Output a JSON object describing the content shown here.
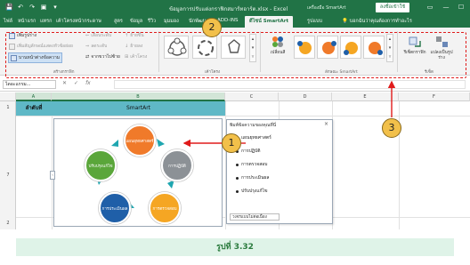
{
  "titlebar": {
    "quick_access": [
      "💾",
      "↶",
      "↷",
      "▣",
      "▾"
    ],
    "doc_title": "ข้อมูลการปรับแต่งกราฟิกสมาร์ทอาร์ต.xlsx - Excel",
    "tools_title": "เครื่องมือ SmartArt",
    "signin": "ลงชื่อเข้าใช้",
    "window_buttons": [
      "▭",
      "—",
      "☐"
    ]
  },
  "tabs": [
    {
      "label": "ไฟล์",
      "active": false
    },
    {
      "label": "หน้าแรก",
      "active": false
    },
    {
      "label": "แทรก",
      "active": false
    },
    {
      "label": "เค้าโครงหน้ากระดาษ",
      "active": false
    },
    {
      "label": "สูตร",
      "active": false
    },
    {
      "label": "ข้อมูล",
      "active": false
    },
    {
      "label": "รีวิว",
      "active": false
    },
    {
      "label": "มุมมอง",
      "active": false
    },
    {
      "label": "นักพัฒนา",
      "active": false
    },
    {
      "label": "ADD-INS",
      "active": false
    },
    {
      "label": "ดีไซน์ SmartArt",
      "active": true
    },
    {
      "label": "รูปแบบ",
      "active": false
    }
  ],
  "tellme": "บอกฉันว่าคุณต้องการทำอะไร",
  "ribbon": {
    "create_graphic": {
      "add_shape": "เพิ่มรูปร่าง",
      "add_bullet": "เพิ่มสัญลักษณ์แสดงหัวข้อย่อย",
      "text_pane": "บานหน้าต่างข้อความ",
      "promote": "เลื่อนระดับ",
      "demote": "ลดระดับ",
      "right_to_left": "จากขวาไปซ้าย",
      "move_up": "ย้ายขึ้น",
      "move_down": "ย้ายลง",
      "layout": "เค้าโครง",
      "label": "สร้างกราฟิก"
    },
    "layouts_label": "เค้าโครง",
    "change_colors": "เปลี่ยนสี",
    "styles_label": "ลักษณะ SmartArt",
    "reset_graphic": "รีเซ็ตกราฟิก",
    "convert": "แปลงเป็นรูปร่าง",
    "reset_label": "รีเซ็ต"
  },
  "formula_bar": {
    "name_box": "ไดอะแกรม...",
    "cancel": "✕",
    "enter": "✓",
    "fx": "fx",
    "value": ""
  },
  "columns": [
    "A",
    "B",
    "C",
    "D",
    "E",
    "F"
  ],
  "rows": [
    "1",
    "7",
    "2"
  ],
  "sheet": {
    "a1": "ลำดับที่",
    "b1": "SmartArt",
    "a7": "7"
  },
  "smartart": {
    "nodes": [
      {
        "label": "แผนยุทธศาสตร์",
        "color": "#f07a2a"
      },
      {
        "label": "การปฏิบัติ",
        "color": "#8c9196"
      },
      {
        "label": "การตรวจสอบ",
        "color": "#f5a623"
      },
      {
        "label": "การประเมินผล",
        "color": "#1f5fa8"
      },
      {
        "label": "ปรับปรุงแก้ไข",
        "color": "#5aa63a"
      }
    ],
    "handle": "‹"
  },
  "text_pane": {
    "title": "พิมพ์ข้อความของคุณที่นี่",
    "close": "×",
    "items": [
      "แผนยุทธศาสตร์",
      "การปฏิบัติ",
      "การตรวจสอบ",
      "การประเมินผล",
      "ปรับปรุงแก้ไข"
    ],
    "footer": "วงจรแบบไม่ต่อเนื่อง"
  },
  "callouts": [
    "1",
    "2",
    "3"
  ],
  "caption": "รูปที่ 3.32",
  "colors": {
    "excel_green": "#217346",
    "header_teal": "#5fb8c6",
    "callout_fill": "#f2c04a",
    "callout_line": "#e01b1b",
    "caption_bg": "#dff3e8",
    "caption_text": "#2a7a3d"
  }
}
